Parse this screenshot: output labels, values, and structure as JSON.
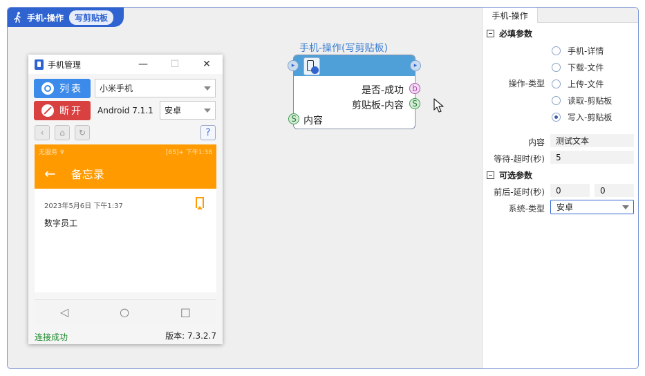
{
  "header": {
    "title": "手机-操作",
    "badge": "写剪贴板"
  },
  "phone_window": {
    "title": "手机管理",
    "win_min": "—",
    "win_max": "☐",
    "win_close": "✕",
    "list_button": "列表",
    "disconnect_button": "断开",
    "device_select": "小米手机",
    "android_version": "Android 7.1.1",
    "os_select": "安卓",
    "help": "?",
    "screen": {
      "status_left": "无服务 ♆",
      "status_right": "[65]+ 下午1:38",
      "app_title": "备忘录",
      "back": "←",
      "memo_date": "2023年5月6日 下午1:37",
      "memo_content": "数字员工",
      "nav_back": "◁",
      "nav_home": "○",
      "nav_recent": "□"
    },
    "status_connected": "连接成功",
    "version": "版本: 7.3.2.7"
  },
  "node": {
    "title": "手机-操作(写剪贴板)",
    "out_success": "是否-成功",
    "out_clipboard": "剪贴板-内容",
    "in_content": "内容",
    "pin_b": "b",
    "pin_s": "S"
  },
  "panel": {
    "tab": "手机-操作",
    "required_section": "必填参数",
    "op_type_label": "操作-类型",
    "op_options": [
      "手机-详情",
      "下载-文件",
      "上传-文件",
      "读取-剪贴板",
      "写入-剪贴板"
    ],
    "content_label": "内容",
    "content_value": "测试文本",
    "timeout_label": "等待-超时(秒)",
    "timeout_value": "5",
    "optional_section": "可选参数",
    "delay_label": "前后-延时(秒)",
    "delay_before": "0",
    "delay_after": "0",
    "system_label": "系统-类型",
    "system_value": "安卓"
  },
  "colors": {
    "accent": "#2f63cf",
    "node_header": "#4f9fd9",
    "android_bar": "#ff9a00",
    "success_text": "#1e8a2e",
    "danger": "#d94141"
  }
}
